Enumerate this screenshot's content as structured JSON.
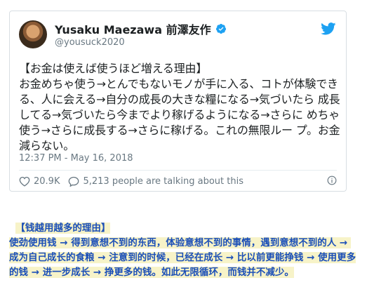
{
  "tweet": {
    "display_name": "Yusaku Maezawa 前澤友作",
    "handle": "@yousuck2020",
    "text": "【お金は使えば使うほど増える理由】\nお金めちゃ使う→とんでもないモノが手に入る、コトが体験でき る、人に会える→自分の成長の大きな糧になる→気づいたら 成長してる→気づいたら今までより稼げるようになる→さらに めちゃ使う→さらに成長する→さらに稼げる。これの無限ルー プ。お金減らない。",
    "timestamp": "12:37 PM - May 16, 2018",
    "likes": "20.9K",
    "talking": "5,213 people are talking about this"
  },
  "translation": {
    "text": "【钱越用越多的理由】\n使劲使用钱 → 得到意想不到的东西，体验意想不到的事情，遇到意想不到的人 → 成为自己成长的食粮 → 注意到的时候，已经在成长 → 比以前更能挣钱 → 使用更多的钱 → 进一步成长 → 挣更多的钱。如此无限循环，而钱并不减少。"
  },
  "colors": {
    "verified": "#1da1f2",
    "twitter_brand": "#1da1f2",
    "translation_text": "#1b4fb8"
  },
  "icons": {
    "verified": "verified-badge-icon",
    "brand": "twitter-bird-icon",
    "like": "heart-icon",
    "reply": "speech-bubble-icon",
    "info": "info-icon"
  }
}
